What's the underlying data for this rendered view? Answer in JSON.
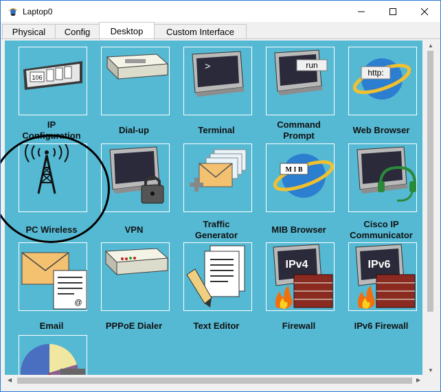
{
  "window": {
    "title": "Laptop0"
  },
  "tabs": [
    {
      "label": "Physical",
      "active": false
    },
    {
      "label": "Config",
      "active": false
    },
    {
      "label": "Desktop",
      "active": true
    },
    {
      "label": "Custom Interface",
      "active": false
    }
  ],
  "apps": [
    {
      "label": "IP\nConfiguration",
      "icon": "ip-configuration-icon"
    },
    {
      "label": "Dial-up",
      "icon": "dial-up-modem-icon"
    },
    {
      "label": "Terminal",
      "icon": "terminal-icon"
    },
    {
      "label": "Command\nPrompt",
      "icon": "command-prompt-icon",
      "icon_text": "run"
    },
    {
      "label": "Web Browser",
      "icon": "web-browser-icon",
      "icon_text": "http:"
    },
    {
      "label": "PC Wireless",
      "icon": "wireless-antenna-icon"
    },
    {
      "label": "VPN",
      "icon": "vpn-lock-icon"
    },
    {
      "label": "Traffic\nGenerator",
      "icon": "traffic-generator-icon"
    },
    {
      "label": "MIB Browser",
      "icon": "mib-browser-icon",
      "icon_text": "M I B"
    },
    {
      "label": "Cisco IP\nCommunicator",
      "icon": "ip-communicator-icon"
    },
    {
      "label": "Email",
      "icon": "email-icon"
    },
    {
      "label": "PPPoE Dialer",
      "icon": "pppoe-dialer-icon"
    },
    {
      "label": "Text Editor",
      "icon": "text-editor-icon"
    },
    {
      "label": "Firewall",
      "icon": "firewall-icon",
      "icon_text": "IPv4"
    },
    {
      "label": "IPv6 Firewall",
      "icon": "ipv6-firewall-icon",
      "icon_text": "IPv6"
    },
    {
      "label": "",
      "icon": "pie-chart-app-icon"
    }
  ],
  "ip_icon_text": "106",
  "colors": {
    "desktop_bg": "#55b9d3",
    "accent": "#2b7bd6"
  }
}
